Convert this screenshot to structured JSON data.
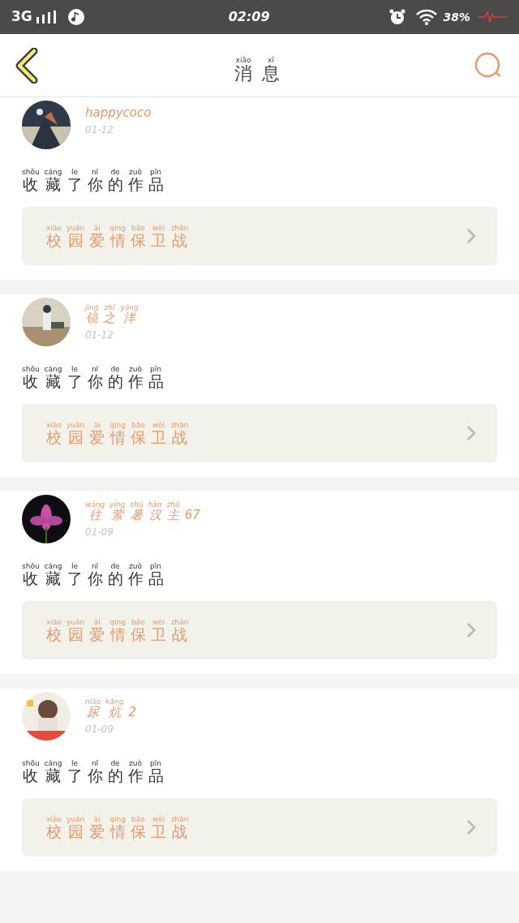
{
  "status_bar": {
    "network": "3G",
    "time": "02:09",
    "battery": "38%"
  },
  "header": {
    "title": [
      {
        "t": "消",
        "p": "xiāo"
      },
      {
        "t": "息",
        "p": "xī"
      }
    ]
  },
  "messages": [
    {
      "avatar": {
        "kind": "picture"
      },
      "user": [
        {
          "t": "happycoco"
        }
      ],
      "date": "01-12",
      "action": [
        {
          "t": "收",
          "p": "shōu"
        },
        {
          "t": "藏",
          "p": "cáng"
        },
        {
          "t": "了",
          "p": "le"
        },
        {
          "t": "你",
          "p": "nǐ"
        },
        {
          "t": "的",
          "p": "de"
        },
        {
          "t": "作",
          "p": "zuò"
        },
        {
          "t": "品",
          "p": "pǐn"
        }
      ],
      "work": [
        {
          "t": "校",
          "p": "xiào"
        },
        {
          "t": "园",
          "p": "yuán"
        },
        {
          "t": "爱",
          "p": "ài"
        },
        {
          "t": "情",
          "p": "qíng"
        },
        {
          "t": "保",
          "p": "bǎo"
        },
        {
          "t": "卫",
          "p": "wèi"
        },
        {
          "t": "战",
          "p": "zhàn"
        }
      ]
    },
    {
      "avatar": {
        "kind": "picture"
      },
      "user": [
        {
          "t": "镜",
          "p": "jìng"
        },
        {
          "t": "之",
          "p": "zhī"
        },
        {
          "t": "洋",
          "p": "yáng"
        }
      ],
      "date": "01-12",
      "action": [
        {
          "t": "收",
          "p": "shōu"
        },
        {
          "t": "藏",
          "p": "cáng"
        },
        {
          "t": "了",
          "p": "le"
        },
        {
          "t": "你",
          "p": "nǐ"
        },
        {
          "t": "的",
          "p": "de"
        },
        {
          "t": "作",
          "p": "zuò"
        },
        {
          "t": "品",
          "p": "pǐn"
        }
      ],
      "work": [
        {
          "t": "校",
          "p": "xiào"
        },
        {
          "t": "园",
          "p": "yuán"
        },
        {
          "t": "爱",
          "p": "ài"
        },
        {
          "t": "情",
          "p": "qíng"
        },
        {
          "t": "保",
          "p": "bǎo"
        },
        {
          "t": "卫",
          "p": "wèi"
        },
        {
          "t": "战",
          "p": "zhàn"
        }
      ]
    },
    {
      "avatar": {
        "kind": "picture"
      },
      "user": [
        {
          "t": "往",
          "p": "wǎng"
        },
        {
          "t": "萦",
          "p": "yíng"
        },
        {
          "t": "暑",
          "p": "shǔ"
        },
        {
          "t": "汉",
          "p": "hàn"
        },
        {
          "t": "主",
          "p": "zhǔ"
        },
        {
          "t": "67"
        }
      ],
      "date": "01-09",
      "action": [
        {
          "t": "收",
          "p": "shōu"
        },
        {
          "t": "藏",
          "p": "cáng"
        },
        {
          "t": "了",
          "p": "le"
        },
        {
          "t": "你",
          "p": "nǐ"
        },
        {
          "t": "的",
          "p": "de"
        },
        {
          "t": "作",
          "p": "zuò"
        },
        {
          "t": "品",
          "p": "pǐn"
        }
      ],
      "work": [
        {
          "t": "校",
          "p": "xiào"
        },
        {
          "t": "园",
          "p": "yuán"
        },
        {
          "t": "爱",
          "p": "ài"
        },
        {
          "t": "情",
          "p": "qíng"
        },
        {
          "t": "保",
          "p": "bǎo"
        },
        {
          "t": "卫",
          "p": "wèi"
        },
        {
          "t": "战",
          "p": "zhàn"
        }
      ]
    },
    {
      "avatar": {
        "kind": "picture"
      },
      "user": [
        {
          "t": "尿",
          "p": "niào"
        },
        {
          "t": "炕",
          "p": "kàng"
        },
        {
          "t": "2"
        }
      ],
      "date": "01-09",
      "action": [
        {
          "t": "收",
          "p": "shōu"
        },
        {
          "t": "藏",
          "p": "cáng"
        },
        {
          "t": "了",
          "p": "le"
        },
        {
          "t": "你",
          "p": "nǐ"
        },
        {
          "t": "的",
          "p": "de"
        },
        {
          "t": "作",
          "p": "zuò"
        },
        {
          "t": "品",
          "p": "pǐn"
        }
      ],
      "work": [
        {
          "t": "校",
          "p": "xiào"
        },
        {
          "t": "园",
          "p": "yuán"
        },
        {
          "t": "爱",
          "p": "ài"
        },
        {
          "t": "情",
          "p": "qíng"
        },
        {
          "t": "保",
          "p": "bǎo"
        },
        {
          "t": "卫",
          "p": "wèi"
        },
        {
          "t": "战",
          "p": "zhàn"
        }
      ]
    }
  ]
}
